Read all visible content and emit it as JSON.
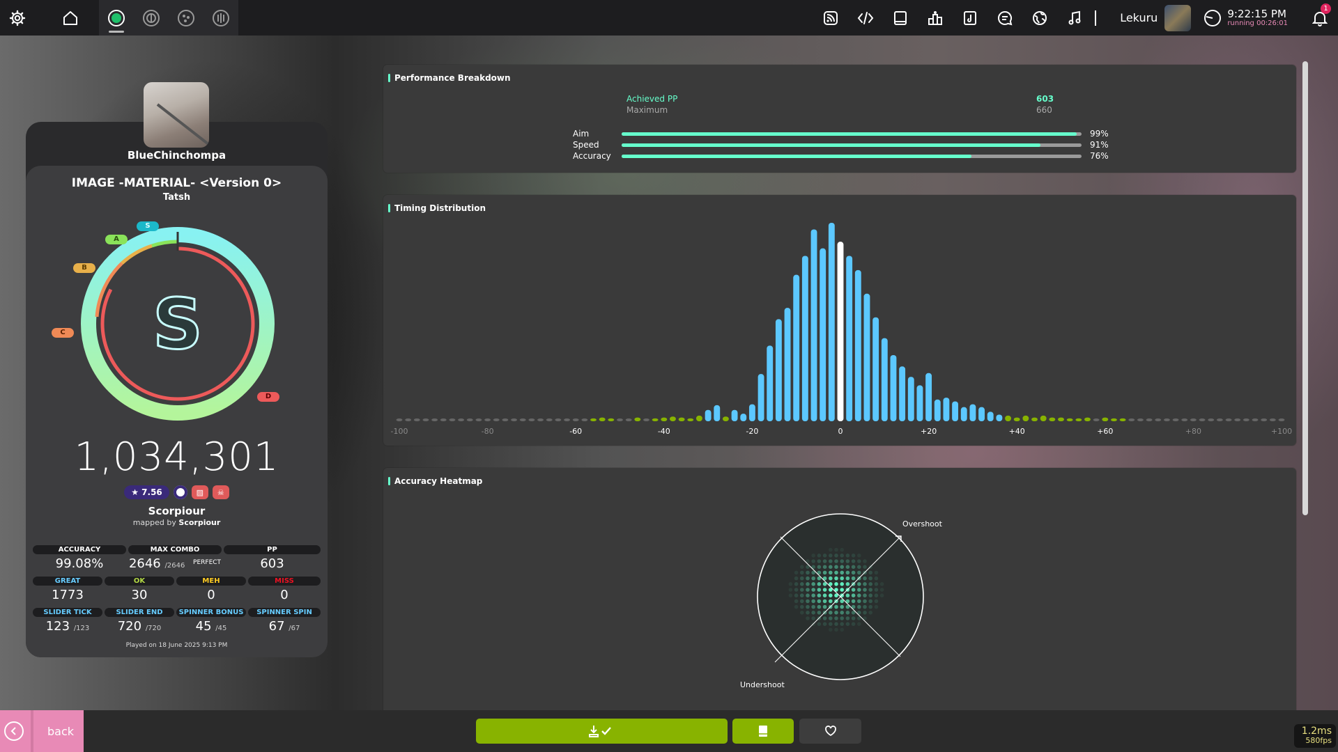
{
  "toolbar": {
    "left_icons": [
      "settings-icon",
      "home-icon",
      "osu-ruleset-icon",
      "taiko-ruleset-icon",
      "catch-ruleset-icon",
      "mania-ruleset-icon"
    ],
    "right_icons": [
      "news-icon",
      "code-icon",
      "wiki-icon",
      "rankings-icon",
      "beatmap-listing-icon",
      "chat-icon",
      "social-icon",
      "music-icon"
    ],
    "username": "Lekuru",
    "clock_time": "9:22:15 PM",
    "clock_running": "running 00:26:01",
    "notification_count": "1"
  },
  "score_card": {
    "player_name": "BlueChinchompa",
    "beatmap_title": "IMAGE -MATERIAL- <Version 0>",
    "beatmap_artist": "Tatsh",
    "rank": "S",
    "rank_badges": {
      "s": "S",
      "a": "A",
      "b": "B",
      "c": "C",
      "d": "D"
    },
    "accuracy_fraction": 0.9908,
    "total_score": "1,034,301",
    "star_rating": "★ 7.56",
    "mapper": "Scorpiour",
    "mapped_by_prefix": "mapped by",
    "mapped_by_name": "Scorpiour",
    "stats": {
      "accuracy_label": "ACCURACY",
      "accuracy_value": "99.08%",
      "max_combo_label": "MAX COMBO",
      "max_combo_value": "2646",
      "max_combo_max": "/2646",
      "perfect_label": "PERFECT",
      "pp_label": "PP",
      "pp_value": "603",
      "great_label": "GREAT",
      "great_value": "1773",
      "ok_label": "OK",
      "ok_value": "30",
      "meh_label": "MEH",
      "meh_value": "0",
      "miss_label": "MISS",
      "miss_value": "0",
      "slider_tick_label": "SLIDER TICK",
      "slider_tick_value": "123",
      "slider_tick_max": "/123",
      "slider_end_label": "SLIDER END",
      "slider_end_value": "720",
      "slider_end_max": "/720",
      "spinner_bonus_label": "SPINNER BONUS",
      "spinner_bonus_value": "45",
      "spinner_bonus_max": "/45",
      "spinner_spin_label": "SPINNER SPIN",
      "spinner_spin_value": "67",
      "spinner_spin_max": "/67"
    },
    "played_on": "Played on 18 June 2025 9:13 PM"
  },
  "performance": {
    "title": "Performance Breakdown",
    "achieved_label": "Achieved PP",
    "achieved_value": "603",
    "maximum_label": "Maximum",
    "maximum_value": "660",
    "bars": [
      {
        "label": "Aim",
        "value": "99%",
        "fraction": 0.99
      },
      {
        "label": "Speed",
        "value": "91%",
        "fraction": 0.91
      },
      {
        "label": "Accuracy",
        "value": "76%",
        "fraction": 0.76
      }
    ]
  },
  "timing": {
    "title": "Timing Distribution",
    "tick_labels": [
      "-100",
      "-80",
      "-60",
      "-40",
      "-20",
      "0",
      "+20",
      "+40",
      "+60",
      "+80",
      "+100"
    ]
  },
  "heatmap": {
    "title": "Accuracy Heatmap",
    "overshoot_label": "Overshoot",
    "undershoot_label": "Undershoot"
  },
  "chart_data": {
    "type": "bar",
    "title": "Timing Distribution",
    "x": [
      -100,
      -98,
      -96,
      -94,
      -92,
      -90,
      -88,
      -86,
      -84,
      -82,
      -80,
      -78,
      -76,
      -74,
      -72,
      -70,
      -68,
      -66,
      -64,
      -62,
      -60,
      -58,
      -56,
      -54,
      -52,
      -50,
      -48,
      -46,
      -44,
      -42,
      -40,
      -38,
      -36,
      -34,
      -32,
      -30,
      -28,
      -26,
      -24,
      -22,
      -20,
      -18,
      -16,
      -14,
      -12,
      -10,
      -8,
      -6,
      -4,
      -2,
      0,
      2,
      4,
      6,
      8,
      10,
      12,
      14,
      16,
      18,
      20,
      22,
      24,
      26,
      28,
      30,
      32,
      34,
      36,
      38,
      40,
      42,
      44,
      46,
      48,
      50,
      52,
      54,
      56,
      58,
      60,
      62,
      64,
      66,
      68,
      70,
      72,
      74,
      76,
      78,
      80,
      82,
      84,
      86,
      88,
      90,
      92,
      94,
      96,
      98,
      100
    ],
    "values": [
      0,
      0,
      0,
      0,
      0,
      0,
      0,
      0,
      0,
      0,
      0,
      0,
      0,
      0,
      0,
      0,
      0,
      0,
      0,
      0,
      0,
      0,
      0.3,
      0.4,
      0.3,
      0,
      0,
      0.4,
      0,
      0.3,
      0.4,
      0.5,
      0.4,
      0.3,
      0.6,
      1.2,
      1.7,
      0.5,
      1.2,
      0.8,
      1.8,
      5,
      8,
      10.8,
      12,
      15.5,
      17.5,
      20.3,
      18.3,
      21,
      19,
      17.5,
      16,
      13.5,
      11,
      8.8,
      7,
      5.8,
      4.7,
      3.8,
      5.1,
      2.3,
      2.5,
      2.1,
      1.5,
      1.8,
      1.5,
      1,
      0.7,
      0.6,
      0.4,
      0.6,
      0.4,
      0.6,
      0.4,
      0.4,
      0.3,
      0.3,
      0.4,
      0,
      0.4,
      0.3,
      0.3,
      0,
      0,
      0,
      0,
      0,
      0,
      0,
      0,
      0,
      0,
      0,
      0,
      0,
      0,
      0,
      0,
      0,
      0
    ],
    "xlim": [
      -100,
      100
    ]
  }
}
